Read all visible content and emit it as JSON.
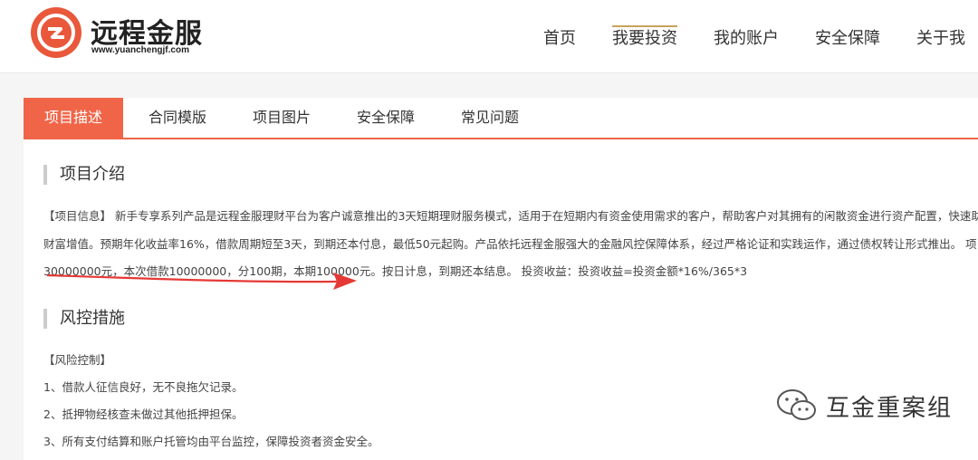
{
  "header": {
    "logo_name": "远程金服",
    "logo_url": "www.yuanchengjf.com",
    "nav": [
      {
        "label": "首页"
      },
      {
        "label": "我要投资",
        "active": true
      },
      {
        "label": "我的账户"
      },
      {
        "label": "安全保障"
      },
      {
        "label": "关于我"
      }
    ]
  },
  "tabs": [
    {
      "label": "项目描述",
      "active": true
    },
    {
      "label": "合同模版"
    },
    {
      "label": "项目图片"
    },
    {
      "label": "安全保障"
    },
    {
      "label": "常见问题"
    }
  ],
  "intro": {
    "title": "项目介绍",
    "line1": "【项目信息】 新手专享系列产品是远程金服理财平台为客户诚意推出的3天短期理财服务模式，适用于在短期内有资金使用需求的客户，帮助客户对其拥有的闲散资金进行资产配置，快速助力客户",
    "line2": "财富增值。预期年化收益率16%，借款周期短至3天，到期还本付息，最低50元起购。产品依托远程金服强大的金融风控保障体系，经过严格论证和实践运作，通过债权转让形式推出。 项目总额",
    "line3": "30000000元，本次借款10000000，分100期，本期100000元。按日计息，到期还本结息。 投资收益：投资收益=投资金额*16%/365*3"
  },
  "risk": {
    "title": "风控措施",
    "heading": "【风险控制】",
    "items": [
      "1、借款人征信良好，无不良拖欠记录。",
      "2、抵押物经核查未做过其他抵押担保。",
      "3、所有支付结算和账户托管均由平台监控，保障投资者资金安全。"
    ]
  },
  "watermark": {
    "text": "互金重案组",
    "icon": "wechat-icon"
  },
  "colors": {
    "accent": "#f06548",
    "logo": "#e9583b",
    "nav_underline": "#c7a45a",
    "arrow": "#e53935"
  }
}
